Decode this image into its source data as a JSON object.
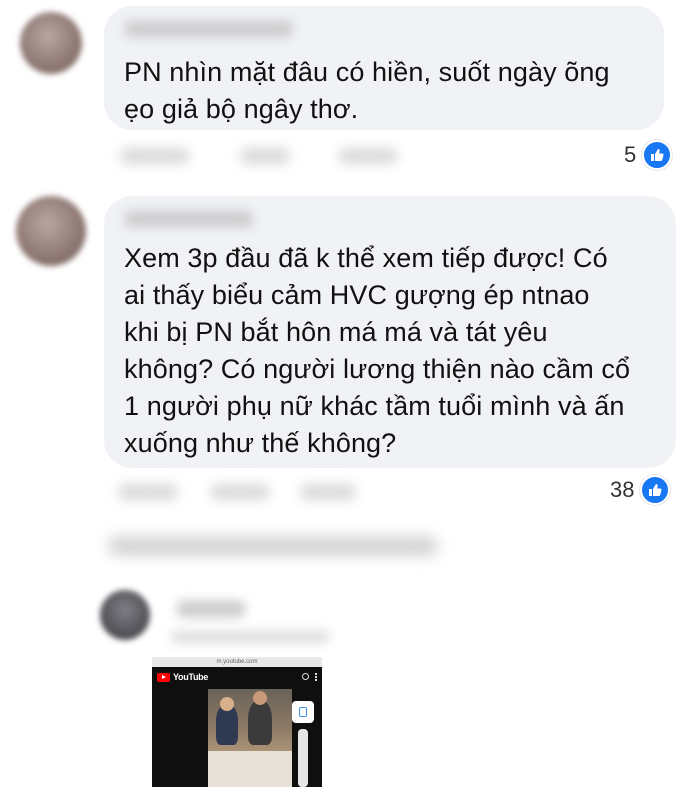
{
  "comments": [
    {
      "text_lines": [
        "PN nhìn mặt đâu có hiền, suốt ngày õng",
        "ẹo giả bộ ngây thơ."
      ],
      "reaction_count": "5",
      "reaction_icon": "like-icon"
    },
    {
      "text_lines": [
        "Xem 3p đầu đã k thể xem tiếp được! Có",
        "ai thấy biểu cảm HVC gượng ép ntnao",
        "khi bị PN bắt hôn má má và tát yêu",
        "không? Có người lương thiện nào cầm cổ",
        "1 người phụ nữ khác tầm tuổi mình và ấn",
        "xuống như thế không?"
      ],
      "reaction_count": "38",
      "reaction_icon": "like-icon"
    }
  ],
  "embed": {
    "brand": "YouTube",
    "url_text": "m.youtube.com"
  },
  "colors": {
    "bubble": "#f0f2f5",
    "like_blue": "#1877f2",
    "youtube_red": "#ff0000"
  }
}
